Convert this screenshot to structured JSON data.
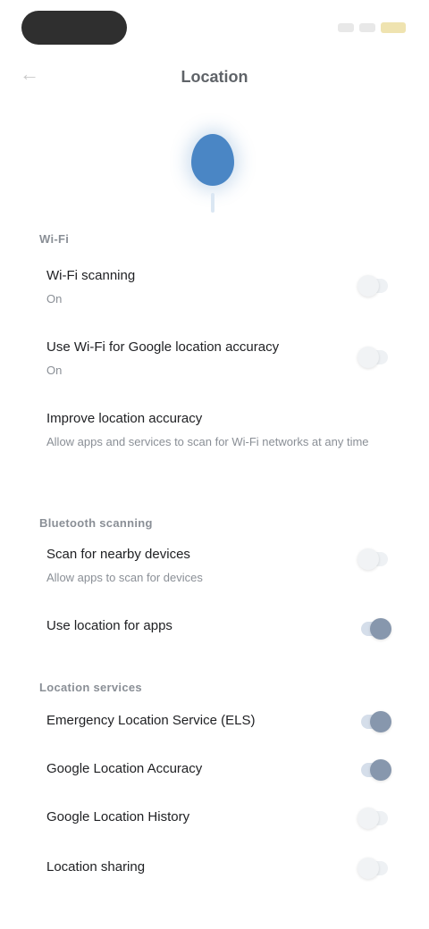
{
  "status_bar": {
    "time": ""
  },
  "header": {
    "title": "Location"
  },
  "sections": [
    {
      "header": "Wi-Fi",
      "rows": [
        {
          "title": "Wi-Fi scanning",
          "sub": "On",
          "toggle": "off"
        },
        {
          "title": "Use Wi-Fi for Google location accuracy",
          "sub": "On",
          "toggle": "off"
        },
        {
          "title": "Improve location accuracy",
          "sub": "Allow apps and services to scan for Wi-Fi networks at any time",
          "toggle": null
        }
      ]
    },
    {
      "header": "Bluetooth scanning",
      "rows": [
        {
          "title": "Scan for nearby devices",
          "sub": "Allow apps to scan for devices",
          "toggle": "off"
        },
        {
          "title": "Use location for apps",
          "sub": "",
          "toggle": "on"
        }
      ]
    },
    {
      "header": "Location services",
      "rows": [
        {
          "title": "Emergency Location Service (ELS)",
          "sub": "",
          "toggle": "on"
        },
        {
          "title": "Google Location Accuracy",
          "sub": "",
          "toggle": "on"
        },
        {
          "title": "Google Location History",
          "sub": "",
          "toggle": "off"
        },
        {
          "title": "Location sharing",
          "sub": "",
          "toggle": "off"
        }
      ]
    }
  ]
}
